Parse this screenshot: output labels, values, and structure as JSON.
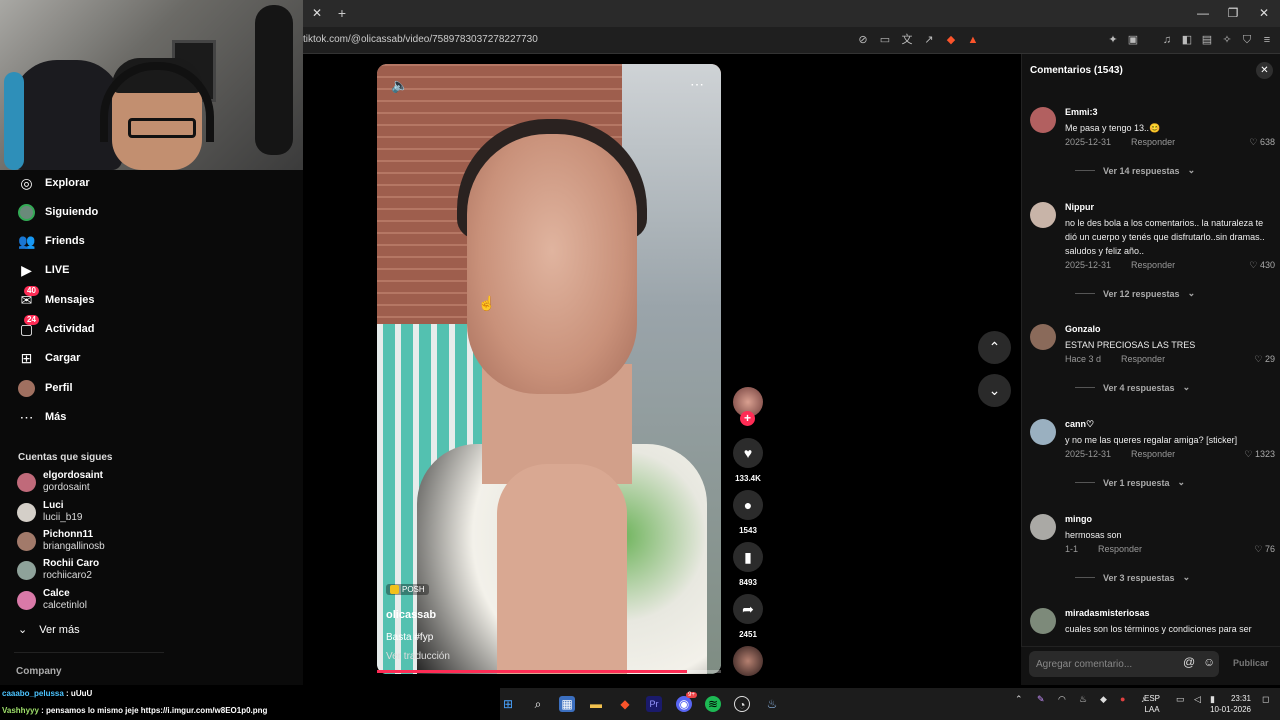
{
  "browser": {
    "url": "tiktok.com/@olicassab/video/7589783037278227730",
    "tab_close": "✕",
    "new_tab": "+",
    "win_min": "—",
    "win_max": "❐",
    "win_close": "✕"
  },
  "sidebar": {
    "items": [
      {
        "label": "Explorar",
        "icon": "compass-icon"
      },
      {
        "label": "Siguiendo",
        "icon": "following-avatar-icon"
      },
      {
        "label": "Friends",
        "icon": "friends-icon"
      },
      {
        "label": "LIVE",
        "icon": "live-icon"
      },
      {
        "label": "Mensajes",
        "icon": "messages-icon",
        "badge": "40"
      },
      {
        "label": "Actividad",
        "icon": "activity-icon",
        "badge": "24"
      },
      {
        "label": "Cargar",
        "icon": "upload-icon"
      },
      {
        "label": "Perfil",
        "icon": "profile-icon"
      },
      {
        "label": "Más",
        "icon": "more-icon"
      }
    ],
    "following_title": "Cuentas que sigues",
    "accounts": [
      {
        "name": "elgordosaint",
        "handle": "gordosaint",
        "color": "#c06a7a"
      },
      {
        "name": "Luci",
        "handle": "lucii_b19",
        "color": "#d4cfc8"
      },
      {
        "name": "Pichonn11",
        "handle": "briangallinosb",
        "color": "#a27a6a"
      },
      {
        "name": "Rochii Caro",
        "handle": "rochiicaro2",
        "color": "#8ea29a"
      },
      {
        "name": "Calce",
        "handle": "calcetinlol",
        "color": "#d979a8"
      }
    ],
    "see_more": "Ver más",
    "company": "Company"
  },
  "video": {
    "badge": "POSH",
    "author": "olicassab",
    "caption": "Basta #fyp",
    "translate": "Ver traducción",
    "progress": 0.9,
    "likes": "133.4K",
    "comments": "1543",
    "saves": "8493",
    "shares": "2451"
  },
  "comments": {
    "title": "Comentarios  (1543)",
    "input_placeholder": "Agregar comentario...",
    "publish": "Publicar",
    "items": [
      {
        "user": "Emmi:3",
        "text": "Me pasa y tengo 13..😊",
        "date": "2025-12-31",
        "reply": "Responder",
        "likes": "638",
        "replies": "Ver 14 respuestas",
        "color": "#b26060"
      },
      {
        "user": "Nippur",
        "text": "no le des bola a los comentarios.. la naturaleza te dió un cuerpo y tenés que disfrutarlo..sin dramas.. saludos y feliz año..",
        "date": "2025-12-31",
        "reply": "Responder",
        "likes": "430",
        "replies": "Ver 12 respuestas",
        "color": "#c8b4a8"
      },
      {
        "user": "Gonzalo",
        "text": "ESTAN PRECIOSAS LAS TRES",
        "date": "Hace 3 d",
        "reply": "Responder",
        "likes": "29",
        "replies": "Ver 4 respuestas",
        "color": "#8a6a5a"
      },
      {
        "user": "cann♡",
        "text": "y no me las queres regalar amiga? [sticker]",
        "date": "2025-12-31",
        "reply": "Responder",
        "likes": "1323",
        "replies": "Ver 1 respuesta",
        "color": "#9ab0c0"
      },
      {
        "user": "mingo",
        "text": "hermosas son",
        "date": "1-1",
        "reply": "Responder",
        "likes": "76",
        "replies": "Ver 3 respuestas",
        "color": "#aaa9a5"
      },
      {
        "user": "miradasmisteriosas",
        "text": "cuales son los términos y condiciones para ser",
        "date": "",
        "reply": "",
        "likes": "",
        "replies": "",
        "color": "#7d8a7a"
      }
    ]
  },
  "chat": {
    "line1_user": "caaabo_pelussa",
    "line1_msg": ": uUuU",
    "line2_user": "Vashhyyy",
    "line2_msg": ": pensamos lo mismo jeje https://i.imgur.com/w8EO1p0.png"
  },
  "taskbar": {
    "lang1": "ESP",
    "lang2": "LAA",
    "time": "23:31",
    "date": "10-01-2026",
    "discord_badge": "9+"
  }
}
